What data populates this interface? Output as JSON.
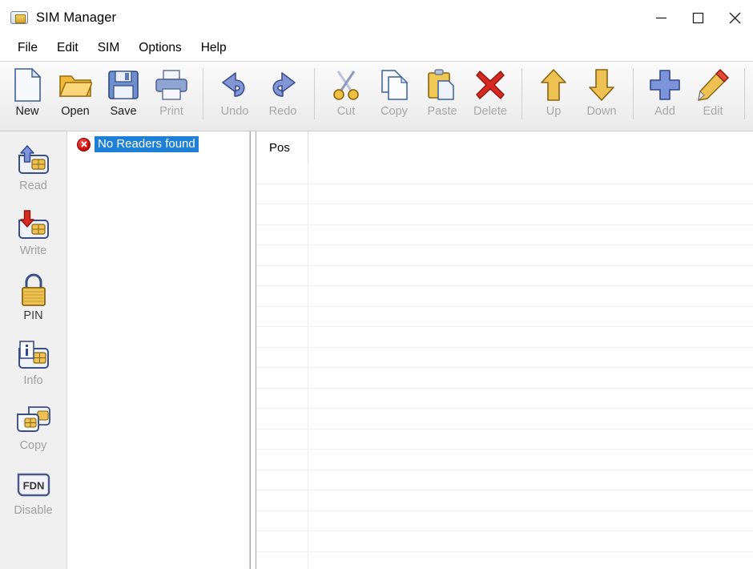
{
  "window": {
    "title": "SIM Manager",
    "icon": "sim-card-icon",
    "controls": {
      "minimize": "minimize-icon",
      "maximize": "maximize-icon",
      "close": "close-icon"
    }
  },
  "menubar": {
    "items": [
      {
        "label": "File"
      },
      {
        "label": "Edit"
      },
      {
        "label": "SIM"
      },
      {
        "label": "Options"
      },
      {
        "label": "Help"
      }
    ]
  },
  "toolbar": {
    "items": [
      {
        "label": "New",
        "icon": "new-document-icon",
        "enabled": true
      },
      {
        "label": "Open",
        "icon": "open-folder-icon",
        "enabled": true
      },
      {
        "label": "Save",
        "icon": "floppy-disk-icon",
        "enabled": true
      },
      {
        "label": "Print",
        "icon": "printer-icon",
        "enabled": false
      },
      {
        "label": "Undo",
        "icon": "undo-arrow-icon",
        "enabled": false
      },
      {
        "label": "Redo",
        "icon": "redo-arrow-icon",
        "enabled": false
      },
      {
        "label": "Cut",
        "icon": "scissors-icon",
        "enabled": false
      },
      {
        "label": "Copy",
        "icon": "copy-pages-icon",
        "enabled": false
      },
      {
        "label": "Paste",
        "icon": "clipboard-icon",
        "enabled": false
      },
      {
        "label": "Delete",
        "icon": "red-x-icon",
        "enabled": false
      },
      {
        "label": "Up",
        "icon": "arrow-up-icon",
        "enabled": false
      },
      {
        "label": "Down",
        "icon": "arrow-down-icon",
        "enabled": false
      },
      {
        "label": "Add",
        "icon": "blue-plus-icon",
        "enabled": false
      },
      {
        "label": "Edit",
        "icon": "pencil-icon",
        "enabled": false
      }
    ],
    "separators_after": [
      "Print",
      "Redo",
      "Delete",
      "Down",
      "Edit"
    ]
  },
  "sidebar": {
    "items": [
      {
        "label": "Read",
        "icon": "sim-read-icon",
        "enabled": false
      },
      {
        "label": "Write",
        "icon": "sim-write-icon",
        "enabled": false
      },
      {
        "label": "PIN",
        "icon": "padlock-icon",
        "enabled": true
      },
      {
        "label": "Info",
        "icon": "sim-info-icon",
        "enabled": false
      },
      {
        "label": "Copy",
        "icon": "sim-copy-icon",
        "enabled": false
      },
      {
        "label": "Disable",
        "icon": "fdn-icon",
        "enabled": false
      }
    ]
  },
  "tree": {
    "nodes": [
      {
        "label": "No Readers found",
        "icon": "error-x-icon",
        "selected": true
      }
    ]
  },
  "grid": {
    "columns": [
      {
        "label": "Pos"
      },
      {
        "label": ""
      }
    ],
    "rows": [],
    "empty_row_count": 20
  },
  "colors": {
    "selection": "#1d7fd6",
    "toolbar_bg": "#f2f2f2",
    "sidebar_bg": "#f0f0f0",
    "error_red": "#d00f0f",
    "disabled_text": "#a8a8a8"
  }
}
